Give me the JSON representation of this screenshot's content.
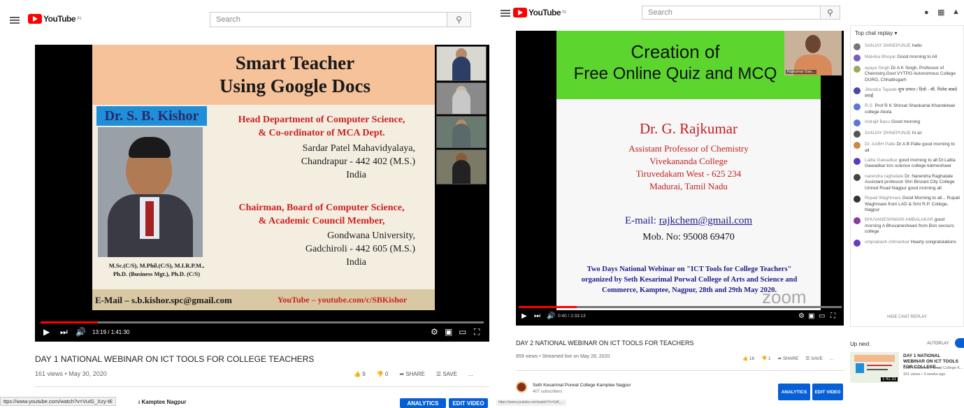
{
  "left": {
    "header": {
      "logo": "YouTube",
      "logo_sup": "IN",
      "search_placeholder": "Search"
    },
    "slide": {
      "title_line1": "Smart Teacher",
      "title_line2": "Using Google Docs",
      "name_box": "Dr. S. B. Kishor",
      "role1_line1": "Head Department of Computer Science,",
      "role1_line2": "& Co-ordinator of MCA Dept.",
      "inst1_line1": "Sardar Patel Mahavidyalaya,",
      "inst1_line2": "Chandrapur - 442 402 (M.S.)",
      "inst1_line3": "India",
      "role2_line1": "Chairman, Board of Computer Science,",
      "role2_line2": "& Academic Council Member,",
      "inst2_line1": "Gondwana University,",
      "inst2_line2": "Gadchiroli - 442 605 (M.S.)",
      "inst2_line3": "India",
      "quals_line1": "M.Sc.(C/S), M.Phil.(C/S), M.I.R.P.M.,",
      "quals_line2": "Ph.D. (Business Mgt.), Ph.D. (C/S)",
      "email": "E-Mail – s.b.kishor.spc@gmail.com",
      "youtube": "YouTube – youtube.com/c/SBKishor"
    },
    "player": {
      "time": "13:19 / 1:41:30",
      "progress": 0.13
    },
    "video_title": "DAY 1 NATIONAL WEBINAR ON ICT TOOLS FOR COLLEGE TEACHERS",
    "meta": "161 views • May 30, 2020",
    "likes": "9",
    "dislikes": "0",
    "share": "SHARE",
    "save": "SAVE",
    "more": "...",
    "status_url": "ttps://www.youtube.com/watch?v=VuIG_Xzy-tE",
    "channel": "ı Kamptee Nagpur",
    "analytics": "ANALYTICS",
    "edit": "EDIT VIDEO"
  },
  "right": {
    "header": {
      "logo": "YouTube",
      "logo_sup": "IN",
      "search_placeholder": "Search"
    },
    "slide": {
      "title_line1": "Creation of",
      "title_line2": "Free Online Quiz and MCQ",
      "name": "Dr. G. Rajkumar",
      "line1": "Assistant Professor of Chemistry",
      "line2": "Vivekananda College",
      "line3": "Tiruvedakam West - 625 234",
      "line4": "Madurai, Tamil Nadu",
      "email_label": "E-mail: ",
      "email": "rajkchem@gmail.com",
      "mob": "Mob. No: 95008 69470",
      "webinar_line1": "Two Days National Webinar on \"ICT Tools for College Teachers\"",
      "webinar_line2": "organized by Seth Kesarimal Porwal College of Arts and Science and",
      "webinar_line3": "Commerce, Kamptee, Nagpur, 28th and 29th May 2020.",
      "zoom": "zoom",
      "cam_label": "Rajkumar Gan..."
    },
    "player": {
      "time": "0:40 / 2:33:13",
      "progress": 0.18
    },
    "video_title": "DAY 2 NATIONAL WEBINAR ON ICT TOOLS FOR TEACHERS",
    "meta": "859 views • Streamed live on May 28, 2020",
    "likes": "16",
    "dislikes": "1",
    "share": "SHARE",
    "save": "SAVE",
    "more": "...",
    "channel_name": "Seth Kesarimal Porwal College Kamptee Nagpur",
    "subscribers": "407 subscribers",
    "analytics": "ANALYTICS",
    "edit": "EDIT VIDEO",
    "status_url": "https://www.youtube.com/watch?v=1d4_...",
    "chat": {
      "header": "Top chat replay ▾",
      "messages": [
        {
          "author": "SANJAY DHNEPUNJE",
          "text": "hello",
          "color": "#777"
        },
        {
          "author": "Malvika Bhoyar",
          "text": "Good morning to All",
          "color": "#7a5cc0"
        },
        {
          "author": "ayaya Singh",
          "text": "Dr A K Singh, Professor of Chemistry,Govt VYTPG Autonomous College DURG, Chhattisgarh",
          "color": "#9aa860"
        },
        {
          "author": "Jitendra Tayade",
          "text": "शुभ प्रभात / दिवो - श्री. निलेश बाबदे शराई",
          "color": "#4a4aa0"
        },
        {
          "author": "R.S.",
          "text": "Prof R K Shirsat Shankarlal Khandelwal college Akola",
          "color": "#5a7ad0"
        },
        {
          "author": "Indrajit Basu",
          "text": "Good morning",
          "color": "#5a7ad0"
        },
        {
          "author": "SANJAY DHNEPUNJE",
          "text": "hi sir",
          "color": "#555"
        },
        {
          "author": "Dr. AABH Palle",
          "text": "Dr A B Palle good morning to all",
          "color": "#cc8844"
        },
        {
          "author": "Lalita Gawadkar",
          "text": "good morning to all Dr.Lalita Gawadkar kzs science college kalmeshwar",
          "color": "#5a3ac0"
        },
        {
          "author": "narendra raghatate",
          "text": "Dr. Narendra Raghatate Assistant professor Shri Binzani City College Umred Road Nagpur good morning all",
          "color": "#444"
        },
        {
          "author": "Rupali Waghmare",
          "text": "Good Morning to all... Rupali Waghmare from LAD & Smt R.P. College, Nagpur",
          "color": "#333"
        },
        {
          "author": "BHUVANESHWARI AMBALAKAR",
          "text": "good morning A Bhuvaneshwari from Bon secours college",
          "color": "#8a3aa0"
        },
        {
          "author": "omprakash chimankar",
          "text": "Hearty congratulations",
          "color": "#6a3ac0"
        }
      ],
      "hide": "HIDE CHAT REPLAY"
    },
    "upnext": {
      "label": "Up next",
      "autoplay": "AUTOPLAY",
      "title": "DAY 1 NATIONAL WEBINAR ON ICT TOOLS FOR COLLEGE...",
      "channel": "Seth Kesarimal Porwal College K...",
      "meta": "161 views • 3 weeks ago",
      "duration": "1:41:31"
    }
  }
}
